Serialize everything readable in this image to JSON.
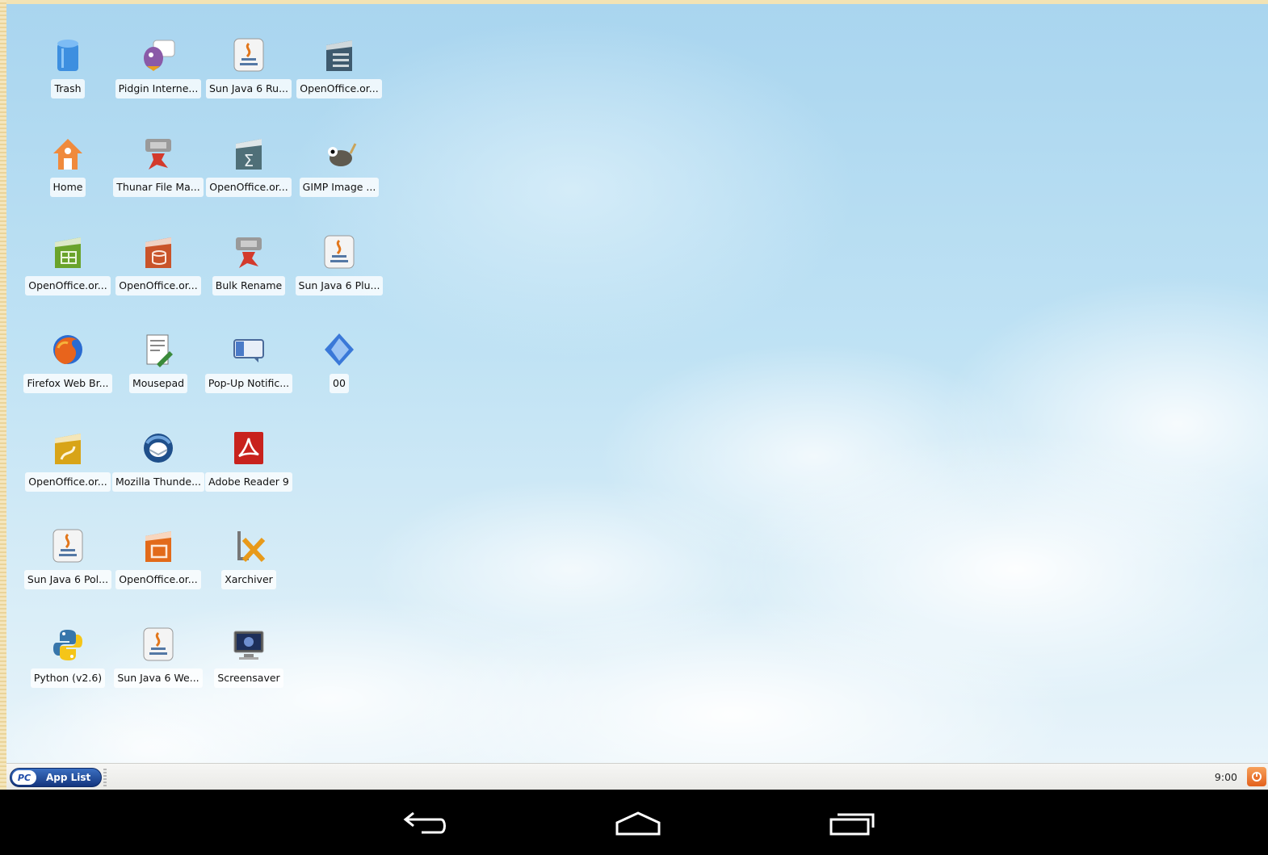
{
  "desktop": {
    "icons": [
      {
        "label": "Trash",
        "icon": "trash-icon"
      },
      {
        "label": "Pidgin Interne...",
        "icon": "pidgin-icon"
      },
      {
        "label": "Sun Java 6 Ru...",
        "icon": "java-icon"
      },
      {
        "label": "OpenOffice.or...",
        "icon": "openoffice-writer-icon"
      },
      {
        "label": "Home",
        "icon": "home-icon"
      },
      {
        "label": "Thunar File Ma...",
        "icon": "thunar-icon"
      },
      {
        "label": "OpenOffice.or...",
        "icon": "openoffice-math-icon"
      },
      {
        "label": "GIMP Image ...",
        "icon": "gimp-icon"
      },
      {
        "label": "OpenOffice.or...",
        "icon": "openoffice-calc-icon"
      },
      {
        "label": "OpenOffice.or...",
        "icon": "openoffice-base-icon"
      },
      {
        "label": "Bulk Rename",
        "icon": "bulk-rename-icon"
      },
      {
        "label": "Sun Java 6 Plu...",
        "icon": "java-icon"
      },
      {
        "label": "Firefox Web Br...",
        "icon": "firefox-icon"
      },
      {
        "label": "Mousepad",
        "icon": "mousepad-icon"
      },
      {
        "label": "Pop-Up Notific...",
        "icon": "notification-icon"
      },
      {
        "label": "00",
        "icon": "folder-icon"
      },
      {
        "label": "OpenOffice.or...",
        "icon": "openoffice-draw-icon"
      },
      {
        "label": "Mozilla Thunde...",
        "icon": "thunderbird-icon"
      },
      {
        "label": "Adobe Reader 9",
        "icon": "adobe-reader-icon"
      },
      {
        "label": "Sun Java 6 Pol...",
        "icon": "java-icon"
      },
      {
        "label": "OpenOffice.or...",
        "icon": "openoffice-impress-icon"
      },
      {
        "label": "Xarchiver",
        "icon": "xarchiver-icon"
      },
      {
        "label": "Python (v2.6)",
        "icon": "python-icon"
      },
      {
        "label": "Sun Java 6 We...",
        "icon": "java-icon"
      },
      {
        "label": "Screensaver",
        "icon": "screensaver-icon"
      }
    ]
  },
  "taskbar": {
    "start_badge": "PC",
    "start_label": "App List",
    "clock": "9:00"
  },
  "navbar": {
    "back_icon": "back-icon",
    "home_icon": "home-nav-icon",
    "recents_icon": "recents-icon"
  },
  "colors": {
    "sky": "#bfe2f4",
    "taskbar": "#eeeeec",
    "start_button": "#1f4a9e",
    "power": "#e8702a",
    "navbar": "#000000"
  }
}
